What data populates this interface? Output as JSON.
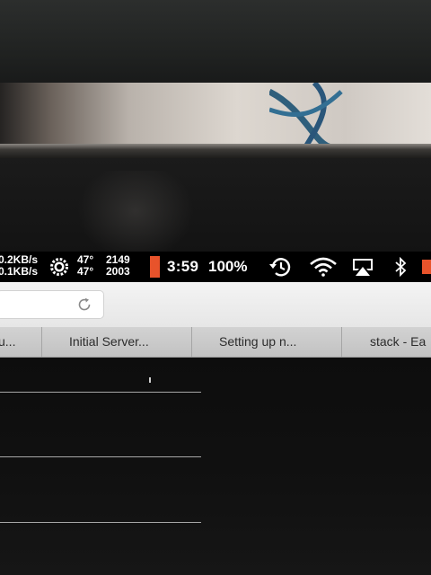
{
  "menubar": {
    "net_up": "0.2KB/s",
    "net_down": "0.1KB/s",
    "temp_cpu": "47°",
    "temp_gpu": "47°",
    "fan_left": "2149",
    "fan_right": "2003",
    "battery_color": "#e8532b",
    "clock": "3:59",
    "battery_percent": "100%",
    "icons": [
      "gear-icon",
      "time-machine-icon",
      "wifi-icon",
      "airplay-icon",
      "bluetooth-icon"
    ]
  },
  "browser": {
    "reload_icon": "reload-icon",
    "tabs": [
      {
        "label": "u..."
      },
      {
        "label": "Initial Server..."
      },
      {
        "label": "Setting up n..."
      },
      {
        "label": "stack - Ea"
      }
    ]
  }
}
